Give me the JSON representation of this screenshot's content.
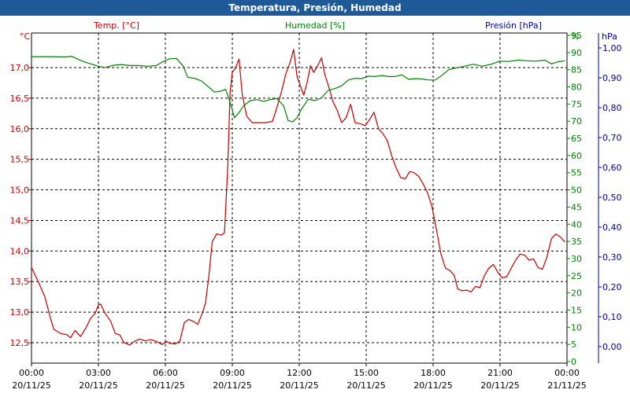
{
  "window": {
    "title": "Temperatura, Presión, Humedad"
  },
  "colors": {
    "temperature": "#c00000",
    "humidity": "#008000",
    "pressure": "#00008b",
    "title_bar": "#1e5a97"
  },
  "chart_data": {
    "type": "line",
    "title": "Temperatura, Presión, Humedad",
    "grid": true,
    "axes": {
      "temperature": {
        "label": "Temp. [°C]",
        "unit": "°C",
        "ylim": [
          12.2,
          17.5
        ],
        "ticks": [
          "12,5",
          "13,0",
          "13,5",
          "14,0",
          "14,5",
          "15,0",
          "15,5",
          "16,0",
          "16,5",
          "17,0"
        ]
      },
      "humidity": {
        "label": "Humedad [%]",
        "unit": "%",
        "ylim": [
          0,
          95
        ],
        "ticks": [
          "0",
          "5",
          "10",
          "15",
          "20",
          "25",
          "30",
          "35",
          "40",
          "45",
          "50",
          "55",
          "60",
          "65",
          "70",
          "75",
          "80",
          "85",
          "90",
          "95"
        ]
      },
      "pressure": {
        "label": "Presión [hPa]",
        "unit": "hPa",
        "ylim": [
          -0.05,
          1.05
        ],
        "ticks": [
          "0,00",
          "0,10",
          "0,20",
          "0,30",
          "0,40",
          "0,50",
          "0,60",
          "0,70",
          "0,80",
          "0,90",
          "1,00"
        ]
      }
    },
    "x_ticks": [
      {
        "time": "00:00",
        "date": "20/11/25"
      },
      {
        "time": "03:00",
        "date": "20/11/25"
      },
      {
        "time": "06:00",
        "date": "20/11/25"
      },
      {
        "time": "09:00",
        "date": "20/11/25"
      },
      {
        "time": "12:00",
        "date": "20/11/25"
      },
      {
        "time": "15:00",
        "date": "20/11/25"
      },
      {
        "time": "18:00",
        "date": "20/11/25"
      },
      {
        "time": "21:00",
        "date": "20/11/25"
      },
      {
        "time": "00:00",
        "date": "21/11/25"
      }
    ],
    "xlim_hours": [
      0,
      24
    ],
    "series": [
      {
        "name": "Temp. [°C]",
        "axis": "temperature",
        "points": [
          [
            0,
            13.73
          ],
          [
            0.3,
            13.5
          ],
          [
            0.6,
            13.25
          ],
          [
            0.85,
            12.9
          ],
          [
            1.0,
            12.72
          ],
          [
            1.3,
            12.65
          ],
          [
            1.6,
            12.63
          ],
          [
            1.75,
            12.58
          ],
          [
            1.95,
            12.7
          ],
          [
            2.2,
            12.6
          ],
          [
            2.45,
            12.75
          ],
          [
            2.65,
            12.9
          ],
          [
            2.85,
            12.98
          ],
          [
            3.0,
            13.12
          ],
          [
            3.1,
            13.13
          ],
          [
            3.3,
            12.98
          ],
          [
            3.55,
            12.85
          ],
          [
            3.75,
            12.65
          ],
          [
            3.95,
            12.63
          ],
          [
            4.15,
            12.5
          ],
          [
            4.4,
            12.46
          ],
          [
            4.6,
            12.52
          ],
          [
            4.85,
            12.56
          ],
          [
            5.1,
            12.53
          ],
          [
            5.35,
            12.55
          ],
          [
            5.6,
            12.52
          ],
          [
            5.85,
            12.47
          ],
          [
            6.05,
            12.52
          ],
          [
            6.2,
            12.49
          ],
          [
            6.45,
            12.48
          ],
          [
            6.65,
            12.53
          ],
          [
            6.85,
            12.83
          ],
          [
            7.05,
            12.88
          ],
          [
            7.25,
            12.85
          ],
          [
            7.45,
            12.8
          ],
          [
            7.65,
            12.98
          ],
          [
            7.8,
            13.15
          ],
          [
            7.95,
            13.6
          ],
          [
            8.1,
            14.15
          ],
          [
            8.3,
            14.28
          ],
          [
            8.5,
            14.26
          ],
          [
            8.65,
            14.3
          ],
          [
            8.8,
            15.4
          ],
          [
            8.9,
            16.6
          ],
          [
            9.0,
            16.92
          ],
          [
            9.15,
            17.0
          ],
          [
            9.3,
            17.14
          ],
          [
            9.45,
            16.55
          ],
          [
            9.65,
            16.2
          ],
          [
            9.9,
            16.1
          ],
          [
            10.2,
            16.1
          ],
          [
            10.5,
            16.1
          ],
          [
            10.8,
            16.12
          ],
          [
            11.0,
            16.35
          ],
          [
            11.2,
            16.6
          ],
          [
            11.4,
            16.9
          ],
          [
            11.6,
            17.1
          ],
          [
            11.75,
            17.3
          ],
          [
            11.9,
            16.85
          ],
          [
            12.05,
            16.7
          ],
          [
            12.2,
            16.55
          ],
          [
            12.35,
            16.75
          ],
          [
            12.5,
            17.03
          ],
          [
            12.65,
            16.92
          ],
          [
            12.85,
            17.05
          ],
          [
            13.0,
            17.16
          ],
          [
            13.15,
            16.88
          ],
          [
            13.35,
            16.65
          ],
          [
            13.5,
            16.45
          ],
          [
            13.7,
            16.3
          ],
          [
            13.9,
            16.1
          ],
          [
            14.1,
            16.18
          ],
          [
            14.3,
            16.4
          ],
          [
            14.5,
            16.1
          ],
          [
            14.75,
            16.08
          ],
          [
            14.95,
            16.05
          ],
          [
            15.15,
            16.15
          ],
          [
            15.35,
            16.27
          ],
          [
            15.55,
            16.0
          ],
          [
            15.75,
            15.92
          ],
          [
            15.95,
            15.8
          ],
          [
            16.15,
            15.55
          ],
          [
            16.35,
            15.35
          ],
          [
            16.55,
            15.2
          ],
          [
            16.75,
            15.18
          ],
          [
            16.95,
            15.3
          ],
          [
            17.15,
            15.28
          ],
          [
            17.35,
            15.22
          ],
          [
            17.55,
            15.1
          ],
          [
            17.75,
            14.95
          ],
          [
            17.95,
            14.72
          ],
          [
            18.15,
            14.35
          ],
          [
            18.35,
            13.95
          ],
          [
            18.55,
            13.72
          ],
          [
            18.75,
            13.68
          ],
          [
            18.95,
            13.6
          ],
          [
            19.1,
            13.38
          ],
          [
            19.3,
            13.35
          ],
          [
            19.5,
            13.36
          ],
          [
            19.7,
            13.33
          ],
          [
            19.9,
            13.42
          ],
          [
            20.1,
            13.4
          ],
          [
            20.3,
            13.6
          ],
          [
            20.5,
            13.72
          ],
          [
            20.7,
            13.78
          ],
          [
            20.9,
            13.65
          ],
          [
            21.1,
            13.56
          ],
          [
            21.3,
            13.58
          ],
          [
            21.5,
            13.72
          ],
          [
            21.7,
            13.85
          ],
          [
            21.9,
            13.95
          ],
          [
            22.1,
            13.93
          ],
          [
            22.3,
            13.85
          ],
          [
            22.5,
            13.87
          ],
          [
            22.7,
            13.73
          ],
          [
            22.9,
            13.7
          ],
          [
            23.1,
            13.9
          ],
          [
            23.3,
            14.2
          ],
          [
            23.5,
            14.28
          ],
          [
            23.7,
            14.23
          ],
          [
            23.9,
            14.15
          ]
        ]
      },
      {
        "name": "Humedad [%]",
        "axis": "humidity",
        "points": [
          [
            0,
            88.8
          ],
          [
            0.5,
            88.8
          ],
          [
            1.0,
            88.8
          ],
          [
            1.5,
            88.7
          ],
          [
            1.8,
            88.9
          ],
          [
            2.1,
            88.0
          ],
          [
            2.4,
            87.2
          ],
          [
            2.7,
            86.6
          ],
          [
            3.0,
            86.0
          ],
          [
            3.3,
            85.6
          ],
          [
            3.6,
            86.2
          ],
          [
            4.0,
            86.5
          ],
          [
            4.4,
            86.2
          ],
          [
            4.8,
            86.2
          ],
          [
            5.2,
            86.0
          ],
          [
            5.6,
            86.2
          ],
          [
            5.9,
            87.4
          ],
          [
            6.2,
            88.2
          ],
          [
            6.5,
            88.3
          ],
          [
            6.8,
            86.0
          ],
          [
            7.0,
            82.8
          ],
          [
            7.3,
            82.5
          ],
          [
            7.6,
            81.8
          ],
          [
            7.9,
            80.2
          ],
          [
            8.2,
            78.5
          ],
          [
            8.5,
            78.8
          ],
          [
            8.7,
            79.3
          ],
          [
            8.9,
            75.5
          ],
          [
            9.1,
            71.0
          ],
          [
            9.3,
            72.5
          ],
          [
            9.5,
            74.5
          ],
          [
            9.8,
            76.0
          ],
          [
            10.1,
            76.3
          ],
          [
            10.4,
            75.8
          ],
          [
            10.7,
            76.3
          ],
          [
            11.0,
            76.6
          ],
          [
            11.3,
            74.5
          ],
          [
            11.5,
            70.2
          ],
          [
            11.7,
            69.8
          ],
          [
            11.9,
            71.0
          ],
          [
            12.1,
            73.5
          ],
          [
            12.4,
            76.4
          ],
          [
            12.7,
            76.0
          ],
          [
            13.0,
            76.8
          ],
          [
            13.3,
            79.0
          ],
          [
            13.6,
            79.5
          ],
          [
            13.9,
            80.3
          ],
          [
            14.2,
            82.0
          ],
          [
            14.5,
            82.5
          ],
          [
            14.8,
            82.4
          ],
          [
            15.1,
            83.1
          ],
          [
            15.4,
            83.0
          ],
          [
            15.7,
            83.3
          ],
          [
            16.0,
            83.0
          ],
          [
            16.3,
            83.0
          ],
          [
            16.6,
            83.5
          ],
          [
            16.9,
            82.2
          ],
          [
            17.2,
            82.4
          ],
          [
            17.5,
            82.3
          ],
          [
            17.8,
            82.0
          ],
          [
            18.1,
            82.0
          ],
          [
            18.4,
            83.4
          ],
          [
            18.7,
            85.0
          ],
          [
            19.0,
            85.5
          ],
          [
            19.4,
            86.0
          ],
          [
            19.8,
            86.6
          ],
          [
            20.2,
            86.0
          ],
          [
            20.6,
            86.6
          ],
          [
            21.0,
            87.5
          ],
          [
            21.4,
            87.4
          ],
          [
            21.8,
            87.8
          ],
          [
            22.2,
            87.6
          ],
          [
            22.6,
            87.5
          ],
          [
            23.0,
            87.8
          ],
          [
            23.3,
            86.7
          ],
          [
            23.6,
            87.3
          ],
          [
            23.9,
            87.6
          ]
        ]
      }
    ]
  }
}
